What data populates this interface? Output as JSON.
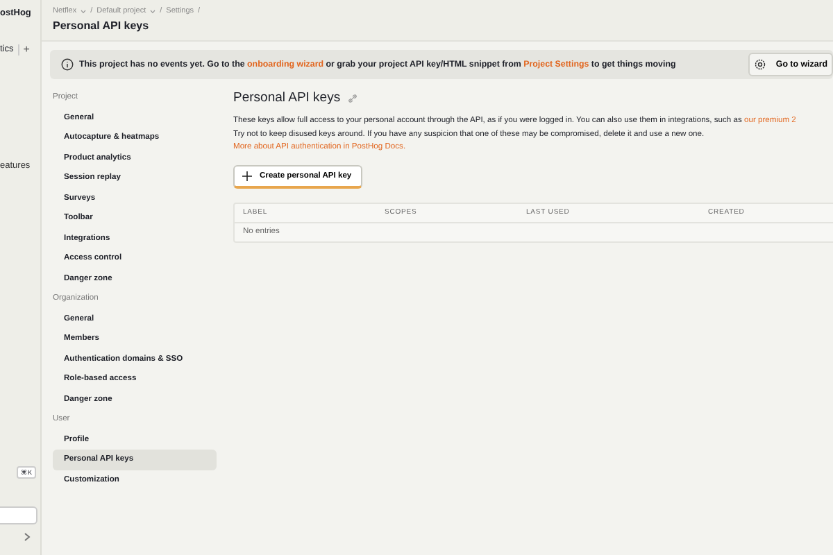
{
  "rail": {
    "brand": "ostHog",
    "tab": "tics",
    "tab_add": "+",
    "item": "eatures",
    "shortcut": "⌘K"
  },
  "breadcrumbs": [
    {
      "label": "Netflex",
      "dropdown": true,
      "separator": "/"
    },
    {
      "label": "Default project",
      "dropdown": true,
      "separator": "/"
    },
    {
      "label": "Settings",
      "dropdown": false,
      "separator": "/"
    }
  ],
  "page_title": "Personal API keys",
  "banner": {
    "parts": [
      {
        "kind": "text",
        "text": "This project has no events yet. Go to the "
      },
      {
        "kind": "link",
        "text": "onboarding wizard"
      },
      {
        "kind": "text",
        "text": " or grab your project API key/HTML snippet from "
      },
      {
        "kind": "link",
        "text": "Project Settings"
      },
      {
        "kind": "text",
        "text": " to get things moving"
      }
    ],
    "button": "Go to wizard"
  },
  "settings_nav": [
    {
      "heading": "Project",
      "items": [
        {
          "label": "General",
          "selected": false
        },
        {
          "label": "Autocapture & heatmaps",
          "selected": false
        },
        {
          "label": "Product analytics",
          "selected": false
        },
        {
          "label": "Session replay",
          "selected": false
        },
        {
          "label": "Surveys",
          "selected": false
        },
        {
          "label": "Toolbar",
          "selected": false
        },
        {
          "label": "Integrations",
          "selected": false
        },
        {
          "label": "Access control",
          "selected": false
        },
        {
          "label": "Danger zone",
          "selected": false
        }
      ]
    },
    {
      "heading": "Organization",
      "items": [
        {
          "label": "General",
          "selected": false
        },
        {
          "label": "Members",
          "selected": false
        },
        {
          "label": "Authentication domains & SSO",
          "selected": false
        },
        {
          "label": "Role-based access",
          "selected": false
        },
        {
          "label": "Danger zone",
          "selected": false
        }
      ]
    },
    {
      "heading": "User",
      "items": [
        {
          "label": "Profile",
          "selected": false
        },
        {
          "label": "Personal API keys",
          "selected": true
        },
        {
          "label": "Customization",
          "selected": false
        }
      ]
    }
  ],
  "section": {
    "title": "Personal API keys",
    "description": "These keys allow full access to your personal account through the API, as if you were logged in. You can also use them in integrations, such as ",
    "description_link": "our premium 2",
    "warning": "Try not to keep disused keys around. If you have any suspicion that one of these may be compromised, delete it and use a new one.",
    "docs_link": "More about API authentication in PostHog Docs.",
    "create_button": "Create personal API key"
  },
  "table": {
    "columns": [
      "LABEL",
      "SCOPES",
      "LAST USED",
      "CREATED"
    ],
    "empty": "No entries"
  }
}
